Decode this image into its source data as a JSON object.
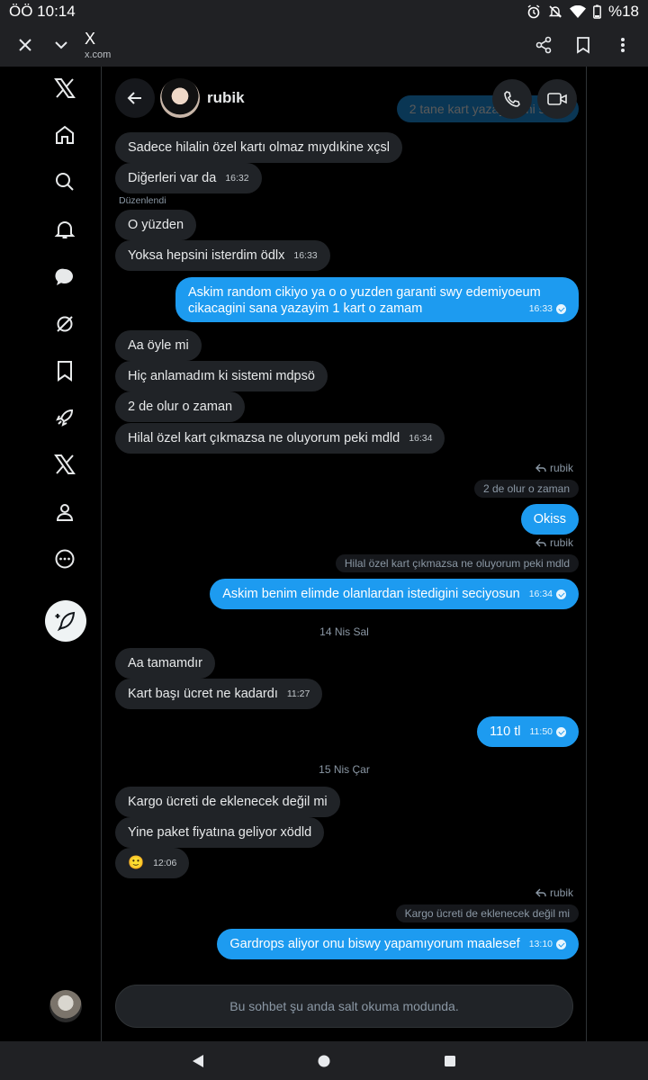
{
  "status": {
    "time": "ÖÖ 10:14",
    "battery": "%18"
  },
  "browser": {
    "title": "X",
    "url": "x.com"
  },
  "header": {
    "contact_name": "rubik",
    "ghost_text": "2 tane kart yazayim mi sana"
  },
  "messages": [
    {
      "text": "Sadece hilalin özel kartı olmaz mıydıkine xçsl",
      "time": ""
    },
    {
      "text": "Diğerleri var da",
      "time": "16:32"
    },
    {
      "text": "O yüzden",
      "time": "",
      "edited": "Düzenlendi"
    },
    {
      "text": "Yoksa hepsini isterdim ödlx",
      "time": "16:33"
    },
    {
      "text_line1": "Askim random cikiyo ya o o yuzden garanti swy edemiyoeum",
      "text_line2": "cikacagini sana yazayim 1 kart o zamam",
      "time": "16:33"
    },
    {
      "text": "Aa öyle mi",
      "time": ""
    },
    {
      "text": "Hiç anlamadım ki sistemi mdpsö",
      "time": ""
    },
    {
      "text": "2 de olur o zaman",
      "time": ""
    },
    {
      "text": "Hilal özel kart çıkmazsa ne oluyorum peki mdld",
      "time": "16:34"
    },
    {
      "reply_to": "rubik",
      "quote": "2 de olur o zaman",
      "text": "Okiss",
      "time": ""
    },
    {
      "reply_to": "rubik",
      "quote": "Hilal özel kart çıkmazsa ne oluyorum peki mdld",
      "text": "Askim benim elimde olanlardan istedigini seciyosun",
      "time": "16:34"
    },
    {
      "date": "14 Nis Sal"
    },
    {
      "text": "Aa tamamdır",
      "time": ""
    },
    {
      "text": "Kart başı ücret ne kadardı",
      "time": "11:27"
    },
    {
      "text": "110 tl",
      "time": "11:50"
    },
    {
      "date": "15 Nis Çar"
    },
    {
      "text": "Kargo ücreti de eklenecek değil mi",
      "time": ""
    },
    {
      "text": "Yine paket fiyatına geliyor xödld",
      "time": ""
    },
    {
      "text": "🙂",
      "time": "12:06"
    },
    {
      "reply_to": "rubik",
      "quote": "Kargo ücreti de eklenecek değil mi",
      "text": "Gardrops aliyor onu biswy yapamıyorum maalesef",
      "time": "13:10"
    }
  ],
  "composer": {
    "readonly_text": "Bu sohbet şu anda salt okuma modunda."
  }
}
